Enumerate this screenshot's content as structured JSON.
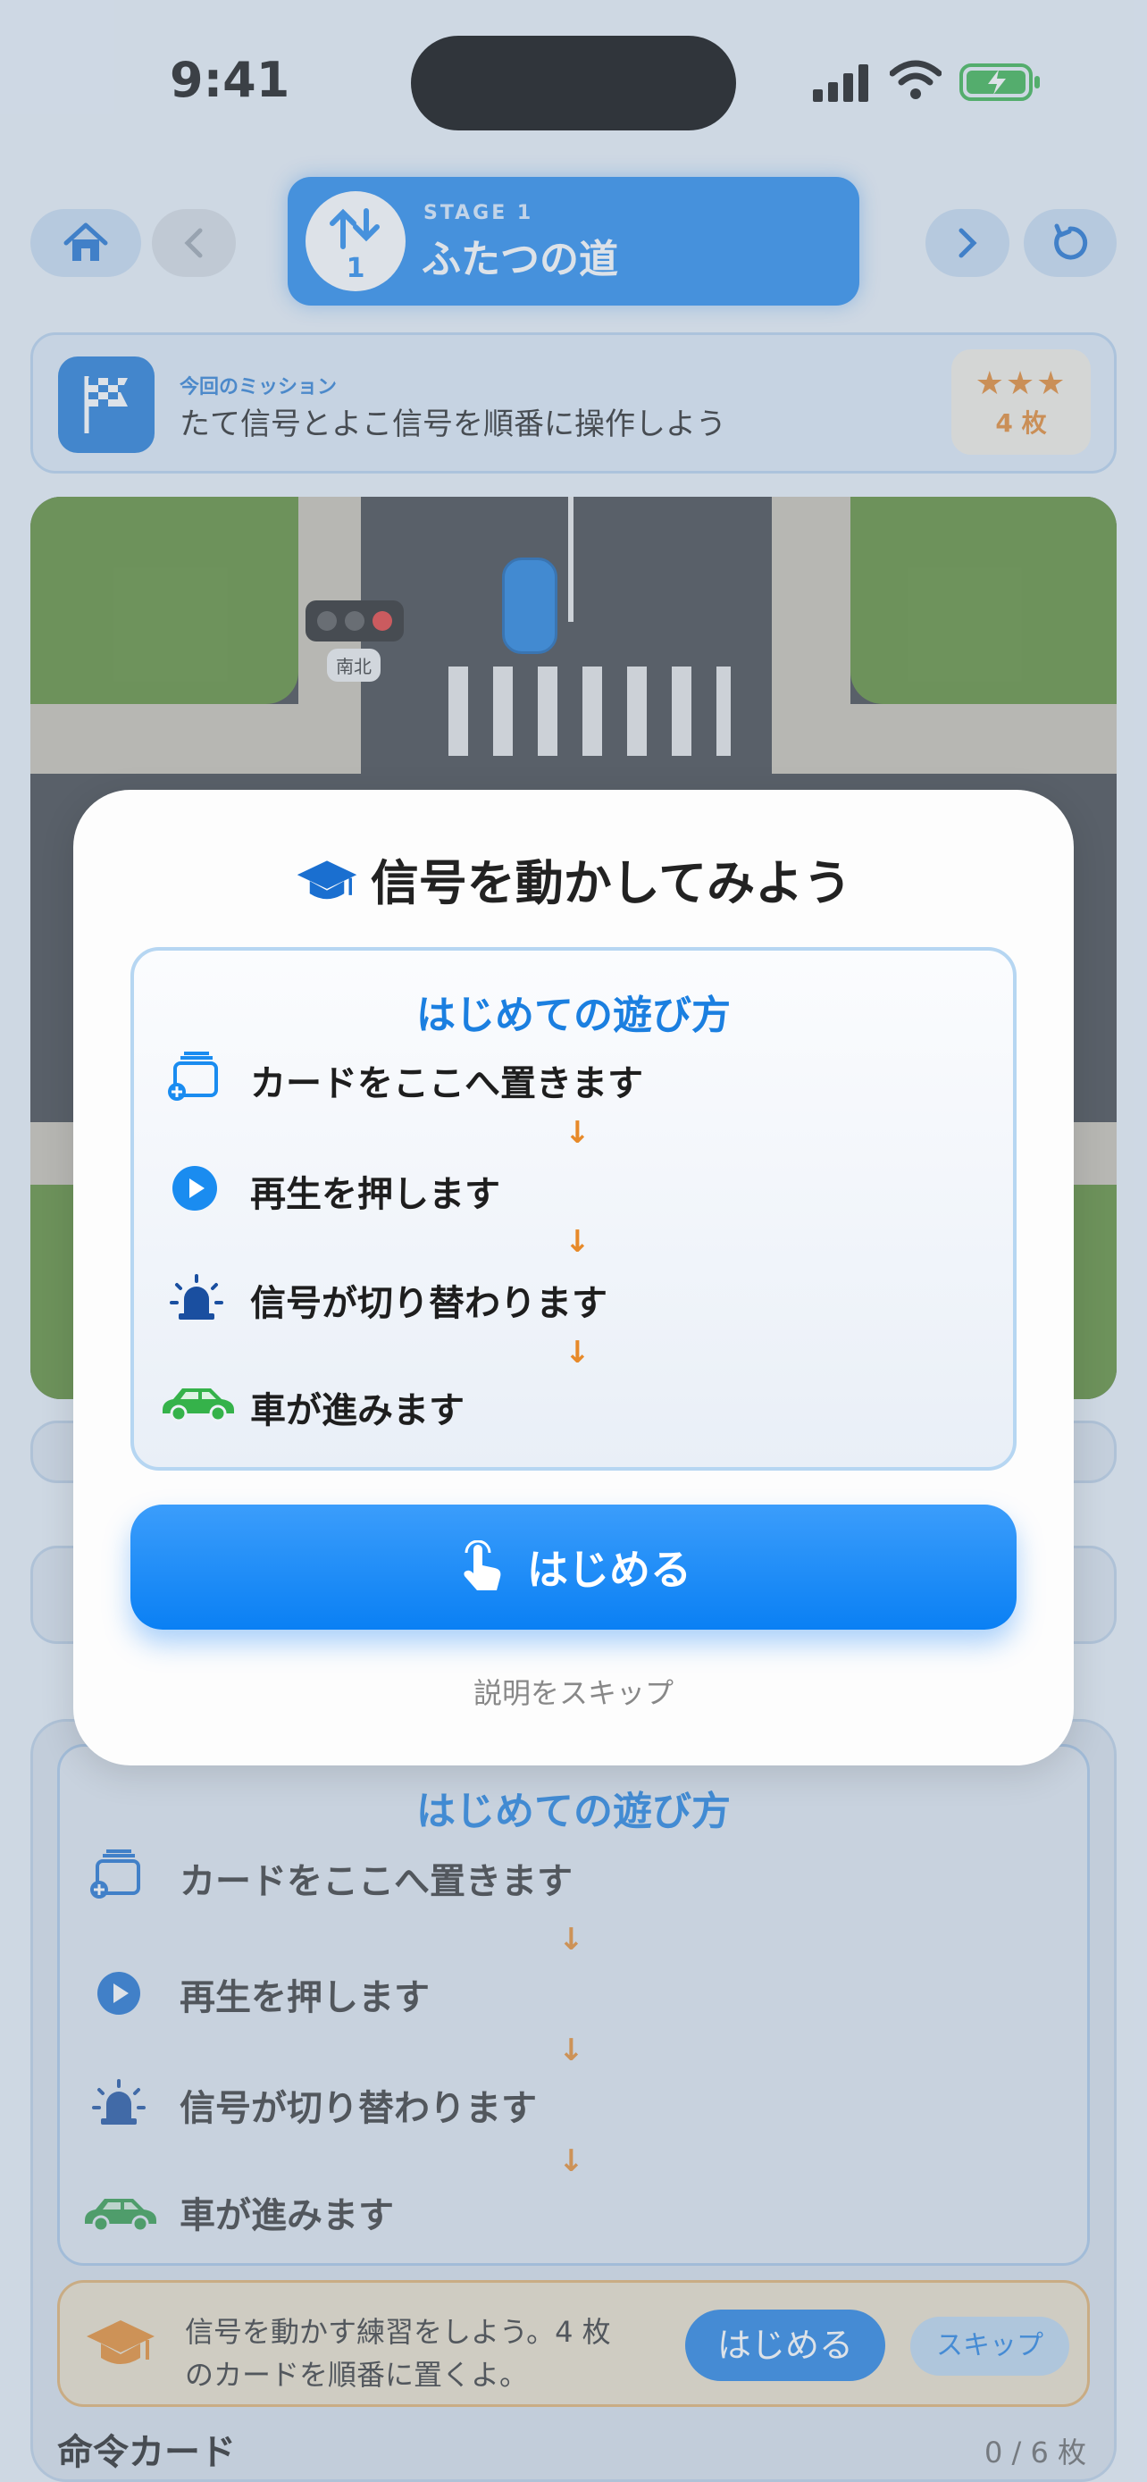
{
  "status": {
    "time": "9:41"
  },
  "header": {
    "stage_label": "STAGE 1",
    "stage_title": "ふたつの道"
  },
  "mission": {
    "label": "今回のミッション",
    "text": "たて信号とよこ信号を順番に操作しよう",
    "stars": "★★★",
    "count": "4 枚"
  },
  "map": {
    "signal_label": "南北"
  },
  "modal": {
    "title": "信号を動かしてみよう",
    "box_title": "はじめての遊び方",
    "steps": [
      "カードをここへ置きます",
      "再生を押します",
      "信号が切り替わります",
      "車が進みます"
    ],
    "arrow": "↓",
    "start_label": "はじめる",
    "skip_label": "説明をスキップ"
  },
  "tutorial": {
    "title": "はじめての遊び方",
    "steps": [
      "カードをここへ置きます",
      "再生を押します",
      "信号が切り替わります",
      "車が進みます"
    ]
  },
  "banner": {
    "text_line1": "信号を動かす練習をしよう。4 枚",
    "text_line2": "のカードを順番に置くよ。",
    "start_label": "はじめる",
    "skip_label": "スキップ"
  },
  "cards": {
    "title": "命令カード",
    "count": "0 / 6 枚"
  },
  "colors": {
    "accent": "#0a80f4",
    "orange": "#e78a2a",
    "green": "#35b24a"
  }
}
